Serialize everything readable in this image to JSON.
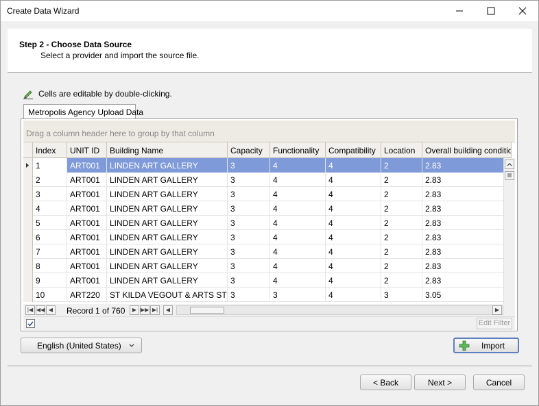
{
  "window": {
    "title": "Create Data Wizard"
  },
  "header": {
    "step_title": "Step 2 - Choose Data Source",
    "step_desc": "Select a provider and import the source file."
  },
  "hint": {
    "text": "Cells are editable by double-clicking.",
    "icon": "pencil-icon"
  },
  "tab": {
    "label": "Metropolis Agency Upload Data"
  },
  "grid": {
    "group_placeholder": "Drag a column header here to group by that column",
    "columns": [
      "Index",
      "UNIT ID",
      "Building Name",
      "Capacity",
      "Functionality",
      "Compatibility",
      "Location",
      "Overall building condition ra"
    ],
    "rows": [
      [
        "1",
        "ART001",
        "LINDEN ART GALLERY",
        "3",
        "4",
        "4",
        "2",
        "2.83"
      ],
      [
        "2",
        "ART001",
        "LINDEN ART GALLERY",
        "3",
        "4",
        "4",
        "2",
        "2.83"
      ],
      [
        "3",
        "ART001",
        "LINDEN ART GALLERY",
        "3",
        "4",
        "4",
        "2",
        "2.83"
      ],
      [
        "4",
        "ART001",
        "LINDEN ART GALLERY",
        "3",
        "4",
        "4",
        "2",
        "2.83"
      ],
      [
        "5",
        "ART001",
        "LINDEN ART GALLERY",
        "3",
        "4",
        "4",
        "2",
        "2.83"
      ],
      [
        "6",
        "ART001",
        "LINDEN ART GALLERY",
        "3",
        "4",
        "4",
        "2",
        "2.83"
      ],
      [
        "7",
        "ART001",
        "LINDEN ART GALLERY",
        "3",
        "4",
        "4",
        "2",
        "2.83"
      ],
      [
        "8",
        "ART001",
        "LINDEN ART GALLERY",
        "3",
        "4",
        "4",
        "2",
        "2.83"
      ],
      [
        "9",
        "ART001",
        "LINDEN ART GALLERY",
        "3",
        "4",
        "4",
        "2",
        "2.83"
      ],
      [
        "10",
        "ART220",
        "ST KILDA VEGOUT & ARTS STUDIO",
        "3",
        "3",
        "4",
        "3",
        "3.05"
      ]
    ],
    "selected_row": 0,
    "record_text": "Record 1 of 760",
    "edit_filter_label": "Edit Filter"
  },
  "language": {
    "selected": "English (United States)"
  },
  "buttons": {
    "import": "Import",
    "back": "< Back",
    "next": "Next >",
    "cancel": "Cancel"
  },
  "colors": {
    "selection": "#7f9ad8",
    "accent_border": "#5c7fc0"
  }
}
